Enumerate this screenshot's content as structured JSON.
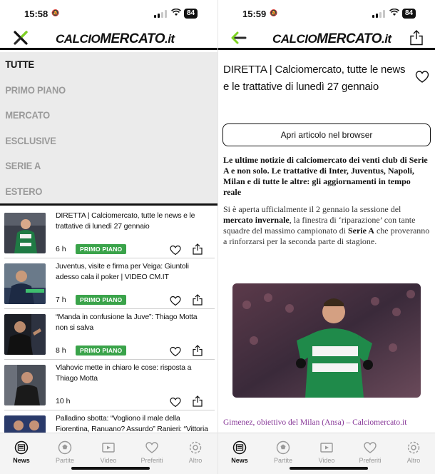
{
  "left": {
    "status": {
      "time": "15:58",
      "battery": "84"
    },
    "logo": {
      "text_pre": "CALCIO",
      "text_main": "MERCATO",
      "text_post": ".it"
    },
    "menu": [
      {
        "label": "TUTTE",
        "active": true
      },
      {
        "label": "PRIMO PIANO",
        "active": false
      },
      {
        "label": "MERCATO",
        "active": false
      },
      {
        "label": "ESCLUSIVE",
        "active": false
      },
      {
        "label": "SERIE A",
        "active": false
      },
      {
        "label": "ESTERO",
        "active": false
      }
    ],
    "news": [
      {
        "title": "DIRETTA | Calciomercato, tutte le news e le trattative di lunedì 27 gennaio",
        "time": "6 h",
        "badge": "PRIMO PIANO"
      },
      {
        "title": "Juventus, visite e firma per Veiga: Giuntoli adesso cala il poker | VIDEO CM.IT",
        "time": "7 h",
        "badge": "PRIMO PIANO"
      },
      {
        "title": "“Manda in confusione la Juve”: Thiago Motta non si salva",
        "time": "8 h",
        "badge": "PRIMO PIANO"
      },
      {
        "title": "Vlahovic mette in chiaro le cose: risposta a Thiago Motta",
        "time": "10 h",
        "badge": ""
      },
      {
        "title": "Palladino sbotta: “Vogliono il male della Fiorentina, Ranuano? Assurdo” Ranieri: “Vittoria",
        "time": "",
        "badge": ""
      }
    ]
  },
  "right": {
    "status": {
      "time": "15:59",
      "battery": "84"
    },
    "logo": {
      "text_pre": "CALCIO",
      "text_main": "MERCATO",
      "text_post": ".it"
    },
    "article": {
      "title": "DIRETTA | Calciomercato, tutte le news e le trattative di lunedì 27 gennaio",
      "browser_button": "Apri articolo nel browser",
      "lead": "Le ultime notizie di calciomercato dei venti club di Serie A e non solo. Le trattative di Inter, Juventus, Napoli, Milan e di tutte le altre: gli aggiornamenti in tempo reale",
      "body_1": "Si è aperta ufficialmente il 2 gennaio la sessione del ",
      "body_bold_1": "mercato invernale",
      "body_2": ", la finestra di ‘riparazione’ con tante squadre del massimo campionato di ",
      "body_bold_2": "Serie A",
      "body_3": " che proveranno a rinforzarsi per la seconda parte di stagione.",
      "caption": "Gimenez, obiettivo del Milan (Ansa) – Calciomercato.it"
    }
  },
  "tabs": [
    {
      "label": "News",
      "icon": "news-icon",
      "active": true
    },
    {
      "label": "Partite",
      "icon": "ball-icon",
      "active": false
    },
    {
      "label": "Video",
      "icon": "video-icon",
      "active": false
    },
    {
      "label": "Preferiti",
      "icon": "heart-icon",
      "active": false
    },
    {
      "label": "Altro",
      "icon": "gear-icon",
      "active": false
    }
  ],
  "colors": {
    "accent_green": "#3aa34a",
    "caption_purple": "#8a3c9a",
    "menu_bg": "#ebebeb"
  }
}
